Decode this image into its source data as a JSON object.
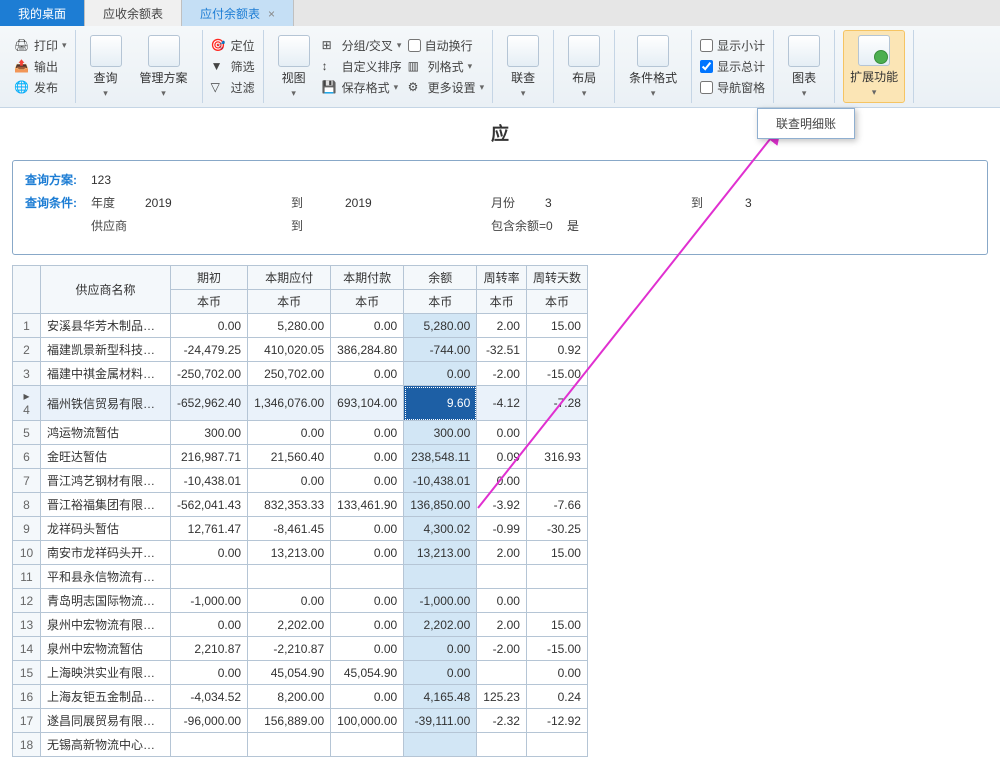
{
  "tabs": {
    "desktop": "我的桌面",
    "ar": "应收余额表",
    "ap": "应付余额表"
  },
  "ribbon": {
    "print": "打印",
    "export": "输出",
    "publish": "发布",
    "query": "查询",
    "manage": "管理方案",
    "locate": "定位",
    "filter": "筛选",
    "filterAdv": "过滤",
    "view": "视图",
    "groupCross": "分组/交叉",
    "customSort": "自定义排序",
    "saveFormat": "保存格式",
    "autoWrap": "自动换行",
    "colFormat": "列格式",
    "moreSettings": "更多设置",
    "linkQuery": "联查",
    "layout": "布局",
    "condFormat": "条件格式",
    "subtotal": "显示小计",
    "grandtotal": "显示总计",
    "navPane": "导航窗格",
    "chart": "图表",
    "extend": "扩展功能"
  },
  "popup": {
    "label": "联查明细账"
  },
  "docTitle": "应",
  "query": {
    "scheme_lbl": "查询方案:",
    "scheme_val": "123",
    "cond_lbl": "查询条件:",
    "year_lbl": "年度",
    "year_from": "2019",
    "to_lbl": "到",
    "year_to": "2019",
    "month_lbl": "月份",
    "month_from": "3",
    "month_to": "3",
    "supplier_lbl": "供应商",
    "supplier_from": "",
    "supplier_to": "",
    "inclzero_lbl": "包含余额=0",
    "inclzero_val": "是"
  },
  "table": {
    "headers": {
      "supplier": "供应商名称",
      "opening": "期初",
      "payable": "本期应付",
      "paid": "本期付款",
      "balance": "余额",
      "rate": "周转率",
      "days": "周转天数",
      "local": "本币"
    },
    "rows": [
      {
        "n": "1",
        "name": "安溪县华芳木制品…",
        "o": "0.00",
        "p": "5,280.00",
        "d": "0.00",
        "b": "5,280.00",
        "r": "2.00",
        "t": "15.00"
      },
      {
        "n": "2",
        "name": "福建凯景新型科技…",
        "o": "-24,479.25",
        "p": "410,020.05",
        "d": "386,284.80",
        "b": "-744.00",
        "r": "-32.51",
        "t": "0.92"
      },
      {
        "n": "3",
        "name": "福建中祺金属材料…",
        "o": "-250,702.00",
        "p": "250,702.00",
        "d": "0.00",
        "b": "0.00",
        "r": "-2.00",
        "t": "-15.00"
      },
      {
        "n": "4",
        "name": "福州铁信贸易有限…",
        "o": "-652,962.40",
        "p": "1,346,076.00",
        "d": "693,104.00",
        "b": "9.60",
        "r": "-4.12",
        "t": "-7.28",
        "sel": true
      },
      {
        "n": "5",
        "name": "鸿运物流暂估",
        "o": "300.00",
        "p": "0.00",
        "d": "0.00",
        "b": "300.00",
        "r": "0.00",
        "t": ""
      },
      {
        "n": "6",
        "name": "金旺达暂估",
        "o": "216,987.71",
        "p": "21,560.40",
        "d": "0.00",
        "b": "238,548.11",
        "r": "0.09",
        "t": "316.93"
      },
      {
        "n": "7",
        "name": "晋江鸿艺钢材有限…",
        "o": "-10,438.01",
        "p": "0.00",
        "d": "0.00",
        "b": "-10,438.01",
        "r": "0.00",
        "t": ""
      },
      {
        "n": "8",
        "name": "晋江裕福集团有限…",
        "o": "-562,041.43",
        "p": "832,353.33",
        "d": "133,461.90",
        "b": "136,850.00",
        "r": "-3.92",
        "t": "-7.66"
      },
      {
        "n": "9",
        "name": "龙祥码头暂估",
        "o": "12,761.47",
        "p": "-8,461.45",
        "d": "0.00",
        "b": "4,300.02",
        "r": "-0.99",
        "t": "-30.25"
      },
      {
        "n": "10",
        "name": "南安市龙祥码头开…",
        "o": "0.00",
        "p": "13,213.00",
        "d": "0.00",
        "b": "13,213.00",
        "r": "2.00",
        "t": "15.00"
      },
      {
        "n": "11",
        "name": "平和县永信物流有…",
        "o": "",
        "p": "",
        "d": "",
        "b": "",
        "r": "",
        "t": ""
      },
      {
        "n": "12",
        "name": "青岛明志国际物流…",
        "o": "-1,000.00",
        "p": "0.00",
        "d": "0.00",
        "b": "-1,000.00",
        "r": "0.00",
        "t": ""
      },
      {
        "n": "13",
        "name": "泉州中宏物流有限…",
        "o": "0.00",
        "p": "2,202.00",
        "d": "0.00",
        "b": "2,202.00",
        "r": "2.00",
        "t": "15.00"
      },
      {
        "n": "14",
        "name": "泉州中宏物流暂估",
        "o": "2,210.87",
        "p": "-2,210.87",
        "d": "0.00",
        "b": "0.00",
        "r": "-2.00",
        "t": "-15.00"
      },
      {
        "n": "15",
        "name": "上海映洪实业有限…",
        "o": "0.00",
        "p": "45,054.90",
        "d": "45,054.90",
        "b": "0.00",
        "r": "",
        "t": "0.00"
      },
      {
        "n": "16",
        "name": "上海友钜五金制品…",
        "o": "-4,034.52",
        "p": "8,200.00",
        "d": "0.00",
        "b": "4,165.48",
        "r": "125.23",
        "t": "0.24"
      },
      {
        "n": "17",
        "name": "遂昌同展贸易有限…",
        "o": "-96,000.00",
        "p": "156,889.00",
        "d": "100,000.00",
        "b": "-39,111.00",
        "r": "-2.32",
        "t": "-12.92"
      },
      {
        "n": "18",
        "name": "无锡高新物流中心…",
        "o": "",
        "p": "",
        "d": "",
        "b": "",
        "r": "",
        "t": ""
      }
    ]
  }
}
